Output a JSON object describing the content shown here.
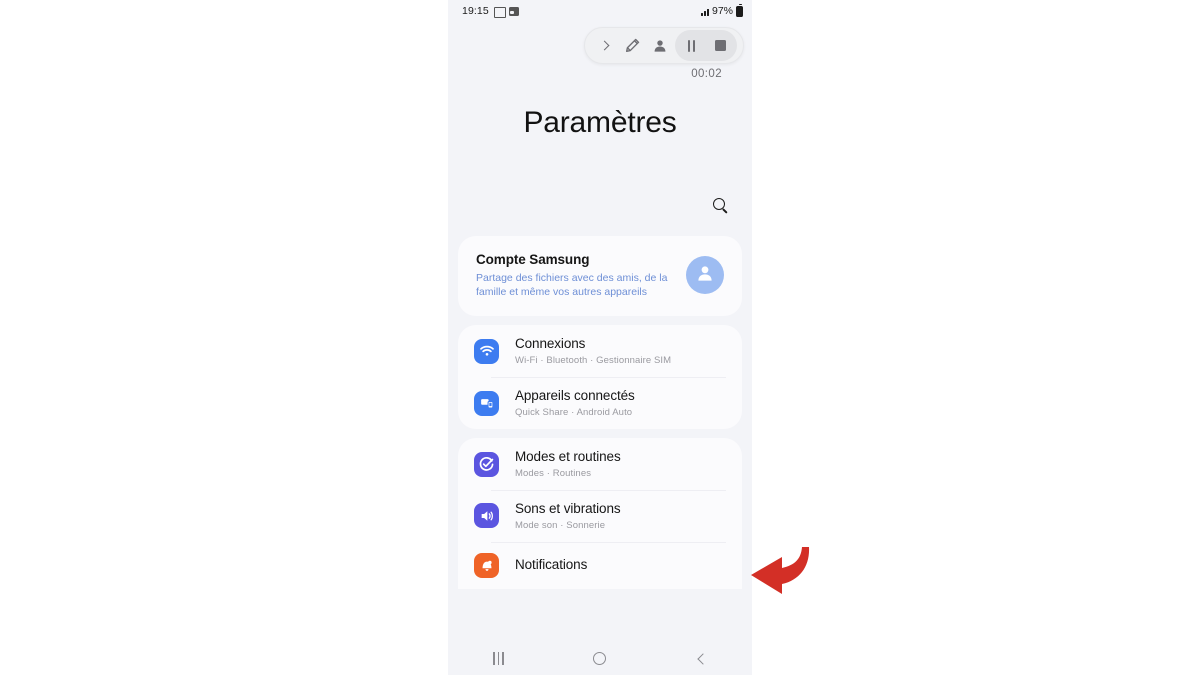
{
  "status_bar": {
    "time": "19:15",
    "battery_percent": "97%",
    "icons": [
      "smart-select-icon",
      "gallery-icon",
      "signal-bars-icon",
      "battery-icon"
    ]
  },
  "recorder_toolbar": {
    "expand_label": "chevron-right-icon",
    "pencil_label": "pencil-icon",
    "person_label": "person-icon",
    "pause_label": "pause-icon",
    "stop_label": "stop-icon",
    "timer": "00:02"
  },
  "header": {
    "title": "Paramètres",
    "search_icon": "search-icon"
  },
  "account_card": {
    "title": "Compte Samsung",
    "subtitle": "Partage des fichiers avec des amis, de la famille et même vos autres appareils",
    "avatar_icon": "person-avatar-icon"
  },
  "sections": [
    {
      "items": [
        {
          "title": "Connexions",
          "subtitle": "Wi-Fi  ·  Bluetooth  ·  Gestionnaire SIM",
          "icon": "wifi-icon",
          "icon_color": "#3d7cf0"
        },
        {
          "title": "Appareils connectés",
          "subtitle": "Quick Share  ·  Android Auto",
          "icon": "connected-devices-icon",
          "icon_color": "#3d7cf0"
        }
      ]
    },
    {
      "items": [
        {
          "title": "Modes et routines",
          "subtitle": "Modes  ·  Routines",
          "icon": "modes-routines-icon",
          "icon_color": "#5b55e0"
        },
        {
          "title": "Sons et vibrations",
          "subtitle": "Mode son  ·  Sonnerie",
          "icon": "sound-vibration-icon",
          "icon_color": "#5b55e0"
        },
        {
          "title": "Notifications",
          "subtitle": "",
          "icon": "notifications-icon",
          "icon_color": "#ef6327"
        }
      ]
    }
  ],
  "nav_bar": {
    "recents_label": "recents-button",
    "home_label": "home-button",
    "back_label": "back-button"
  },
  "annotation": {
    "arrow_color": "#d32f26",
    "arrow_label": "red-curved-arrow"
  },
  "colors": {
    "page_background": "#f3f4f8",
    "card_background": "#fbfbfd",
    "accent_blue": "#3d7cf0",
    "accent_purple": "#5b55e0",
    "accent_orange": "#ef6327",
    "subtitle_blue": "#6e8fd6",
    "annotation_red": "#d32f26"
  }
}
